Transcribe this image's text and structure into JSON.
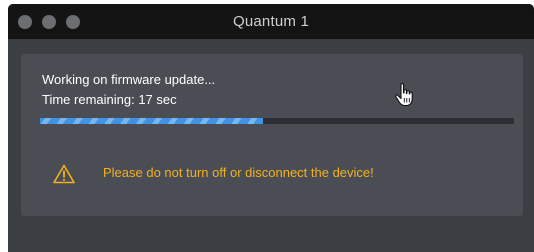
{
  "window": {
    "title": "Quantum 1"
  },
  "update": {
    "status": "Working on firmware update...",
    "time_remaining": "Time remaining:  17 sec",
    "progress_fraction": 0.47
  },
  "warning": {
    "message": "Please do not turn off or disconnect the device!",
    "icon": "warning-triangle-icon"
  },
  "colors": {
    "window_bg": "#3b3f44",
    "panel_bg": "#4a4e54",
    "warning_text": "#f2b01e",
    "progress_blue": "#3f93e6"
  }
}
